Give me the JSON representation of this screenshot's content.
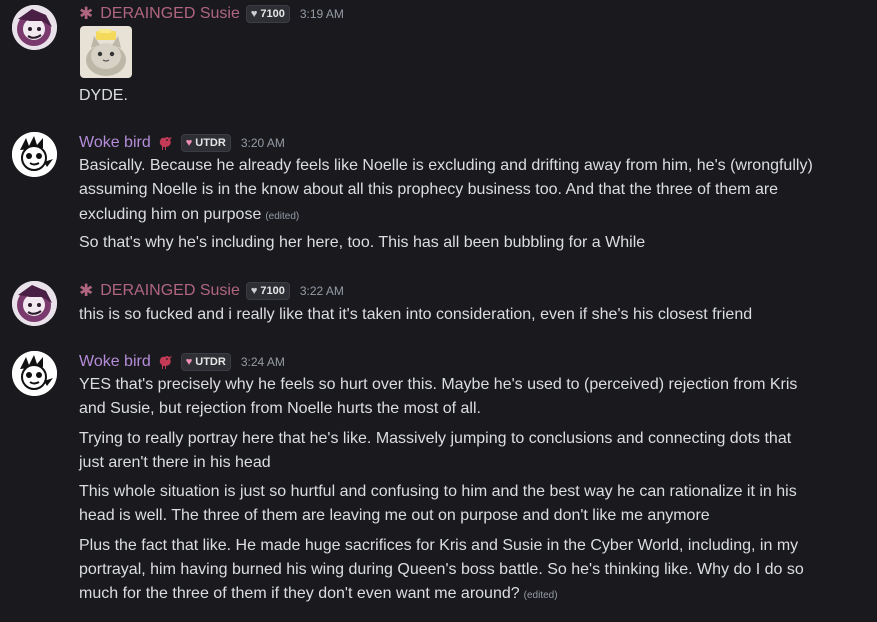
{
  "colors": {
    "background": "#1a1a1e",
    "susie_name": "#b0657e",
    "bird_name": "#b48cd8",
    "text": "#dbdee1",
    "muted": "#949ba4",
    "tag_bg": "#2e2f35",
    "heart_pink": "#f08fb4"
  },
  "messages": [
    {
      "author_prefix": "✱",
      "author": "DERAINGED Susie",
      "tag_icon": "grey-heart-icon",
      "tag": "7100",
      "time": "3:19 AM",
      "sticker": "cat-with-butter-sticker",
      "lines": [
        {
          "text": "DYDE."
        }
      ]
    },
    {
      "author": "Woke bird",
      "author_icon": "bird-emoji-icon",
      "tag_icon": "pink-heart-icon",
      "tag": "UTDR",
      "time": "3:20 AM",
      "lines": [
        {
          "text": "Basically. Because he already feels like Noelle is excluding and drifting away from him, he's (wrongfully)"
        },
        {
          "text": "assuming Noelle is in the know about all this prophecy business too. And that the three of them are"
        },
        {
          "text": "excluding him on purpose",
          "edited": "(edited)"
        },
        {
          "text": "So that's why he's including her here, too. This has all been bubbling for a While"
        }
      ]
    },
    {
      "author_prefix": "✱",
      "author": "DERAINGED Susie",
      "tag_icon": "grey-heart-icon",
      "tag": "7100",
      "time": "3:22 AM",
      "lines": [
        {
          "text": "this is so fucked and i really like that it's taken into consideration, even if she's his closest friend"
        }
      ]
    },
    {
      "author": "Woke bird",
      "author_icon": "bird-emoji-icon",
      "tag_icon": "pink-heart-icon",
      "tag": "UTDR",
      "time": "3:24 AM",
      "lines": [
        {
          "text": "YES that's precisely why he feels so hurt over this. Maybe he's used to (perceived) rejection from Kris"
        },
        {
          "text": "and Susie, but rejection from Noelle hurts the most of all."
        },
        {
          "text": "Trying to really portray here that he's like. Massively jumping to conclusions and connecting dots that"
        },
        {
          "text": "just aren't there in his head"
        },
        {
          "text": "This whole situation is just so hurtful and confusing to him and the best way he can rationalize it in his"
        },
        {
          "text": "head is well. The three of them are leaving me out on purpose and don't like me anymore"
        },
        {
          "text": "Plus the fact that like. He made huge sacrifices for Kris and Susie in the Cyber World, including, in my"
        },
        {
          "text": "portrayal, him having burned his wing during Queen's boss battle. So he's thinking like. Why do I do so"
        },
        {
          "text": "much for the three of them if they don't even want me around?",
          "edited": "(edited)"
        }
      ]
    }
  ]
}
